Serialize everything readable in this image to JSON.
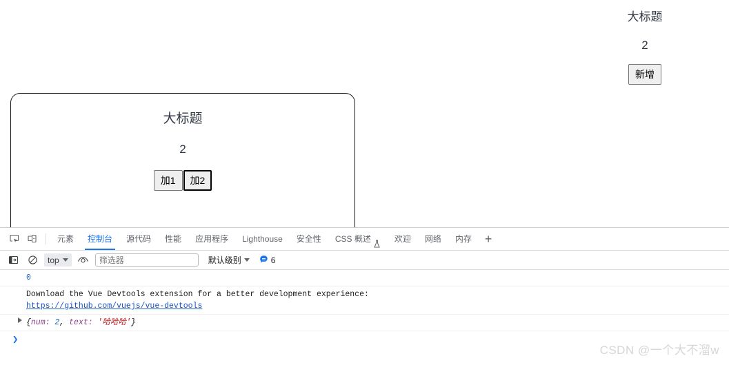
{
  "page": {
    "right_widget": {
      "title": "大标题",
      "count": "2",
      "add_button": "新增"
    },
    "card": {
      "title": "大标题",
      "count": "2",
      "btn_add1": "加1",
      "btn_add2": "加2"
    }
  },
  "devtools": {
    "icons": {
      "inspect": "inspect-element-icon",
      "device": "device-toolbar-icon"
    },
    "tabs": [
      {
        "label": "元素",
        "active": false,
        "flask": false
      },
      {
        "label": "控制台",
        "active": true,
        "flask": false
      },
      {
        "label": "源代码",
        "active": false,
        "flask": false
      },
      {
        "label": "性能",
        "active": false,
        "flask": false
      },
      {
        "label": "应用程序",
        "active": false,
        "flask": false
      },
      {
        "label": "Lighthouse",
        "active": false,
        "flask": false
      },
      {
        "label": "安全性",
        "active": false,
        "flask": false
      },
      {
        "label": "CSS 概述",
        "active": false,
        "flask": true
      },
      {
        "label": "欢迎",
        "active": false,
        "flask": false
      },
      {
        "label": "网络",
        "active": false,
        "flask": false
      },
      {
        "label": "内存",
        "active": false,
        "flask": false
      }
    ],
    "tab_add": "+",
    "console_toolbar": {
      "sidebar_icon": "console-sidebar-icon",
      "clear_icon": "clear-console-icon",
      "context": "top",
      "eye_icon": "live-expression-icon",
      "filter_placeholder": "筛选器",
      "filter_value": "",
      "level": "默认级别",
      "issues_icon": "issues-bubble-icon",
      "issues_count": "6"
    },
    "console_messages": [
      {
        "type": "number",
        "text": "0"
      },
      {
        "type": "info",
        "text": "Download the Vue Devtools extension for a better development experience:",
        "link": "https://github.com/vuejs/vue-devtools"
      },
      {
        "type": "object",
        "brace_open": "{",
        "key1": "num:",
        "val1": "2",
        "comma": ", ",
        "key2": "text:",
        "val2": "'哈哈哈'",
        "brace_close": "}"
      }
    ],
    "prompt_caret": "❯"
  },
  "watermark": "CSDN @一个大不溜w",
  "colors": {
    "accent_blue": "#1a73e8",
    "link_blue": "#1a56c4",
    "number_blue": "#1565c0",
    "string_red": "#c41a16",
    "key_purple": "#8a3f8a",
    "tab_grey": "#5f6368",
    "watermark_grey": "#d6d6d6"
  }
}
